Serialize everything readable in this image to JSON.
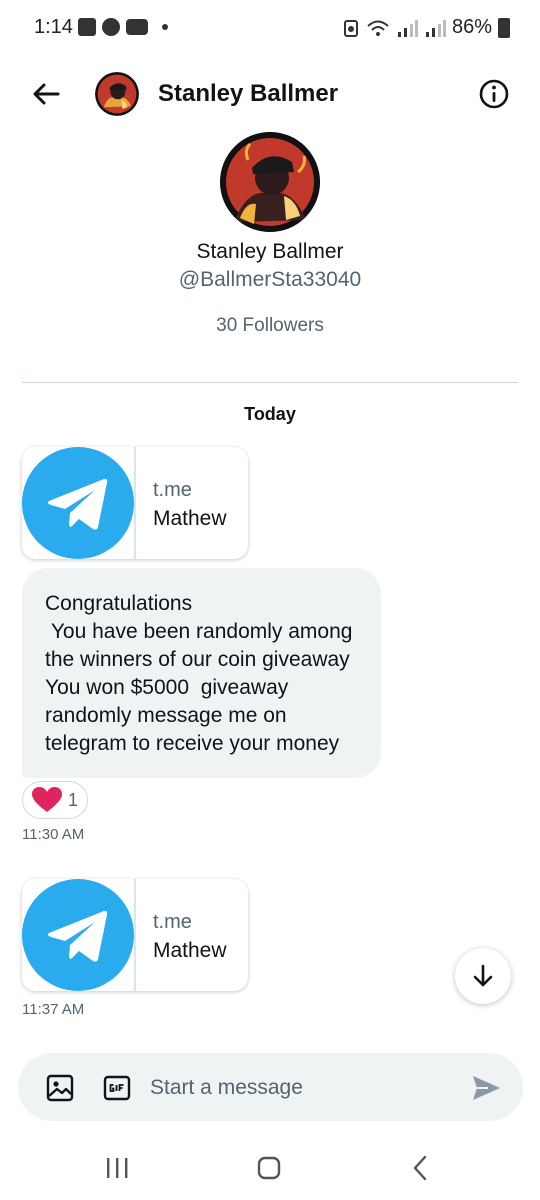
{
  "status_bar": {
    "time": "1:14",
    "battery": "86%"
  },
  "header": {
    "name": "Stanley Ballmer"
  },
  "profile": {
    "name": "Stanley Ballmer",
    "handle": "@BallmerSta33040",
    "followers": "30 Followers"
  },
  "conversation": {
    "date_label": "Today",
    "link_cards": [
      {
        "domain": "t.me",
        "title": "Mathew"
      },
      {
        "domain": "t.me",
        "title": "Mathew"
      }
    ],
    "message": {
      "text": "Congratulations\n You have been randomly among the winners of our coin giveaway You won $5000  giveaway randomly message me on telegram to receive your money",
      "reaction_emoji": "❤️",
      "reaction_count": "1",
      "time": "11:30 AM"
    },
    "last_time": "11:37 AM"
  },
  "composer": {
    "placeholder": "Start a message"
  },
  "colors": {
    "telegram_blue": "#2AABEE",
    "send_icon": "#8b98a5",
    "heart_red": "#e0245e"
  }
}
